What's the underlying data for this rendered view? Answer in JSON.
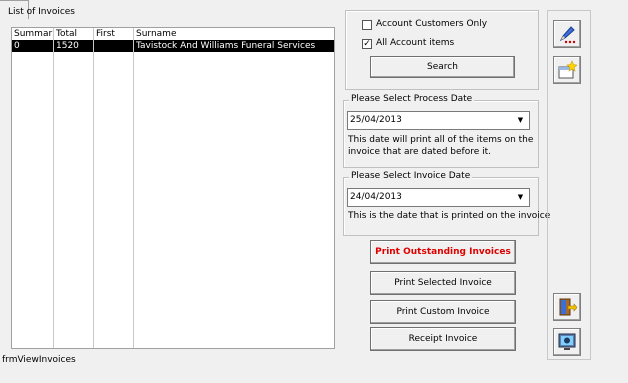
{
  "list": {
    "group_label": "List of Invoices",
    "columns": [
      "Summar",
      "Total",
      "First",
      "Surname"
    ],
    "rows": [
      {
        "summary": "0",
        "total": "1520",
        "first": "",
        "surname": "Tavistock And Williams Funeral Services"
      }
    ]
  },
  "form_name": "frmViewInvoices",
  "filters": {
    "account_customers_only": {
      "label": "Account Customers Only",
      "checked": false
    },
    "all_account_items": {
      "label": "All Account items",
      "checked": true
    },
    "search_label": "Search"
  },
  "process_date": {
    "legend": "Please Select Process Date",
    "value": "25/04/2013",
    "help_line1": "This date will print all of the items on the",
    "help_line2": "invoice that are dated before it."
  },
  "invoice_date": {
    "legend": "Please Select Invoice Date",
    "value": "24/04/2013",
    "help": "This is the date that is printed on the invoice"
  },
  "buttons": {
    "print_outstanding": "Print Outstanding Invoices",
    "print_selected": "Print Selected Invoice",
    "print_custom": "Print Custom Invoice",
    "receipt": "Receipt Invoice"
  },
  "icons": {
    "edit": "pencil-icon",
    "new": "new-item-icon",
    "exit": "exit-door-icon",
    "help": "monitor-help-icon"
  },
  "colors": {
    "accent_red": "#e00000",
    "selection": "#000000"
  }
}
